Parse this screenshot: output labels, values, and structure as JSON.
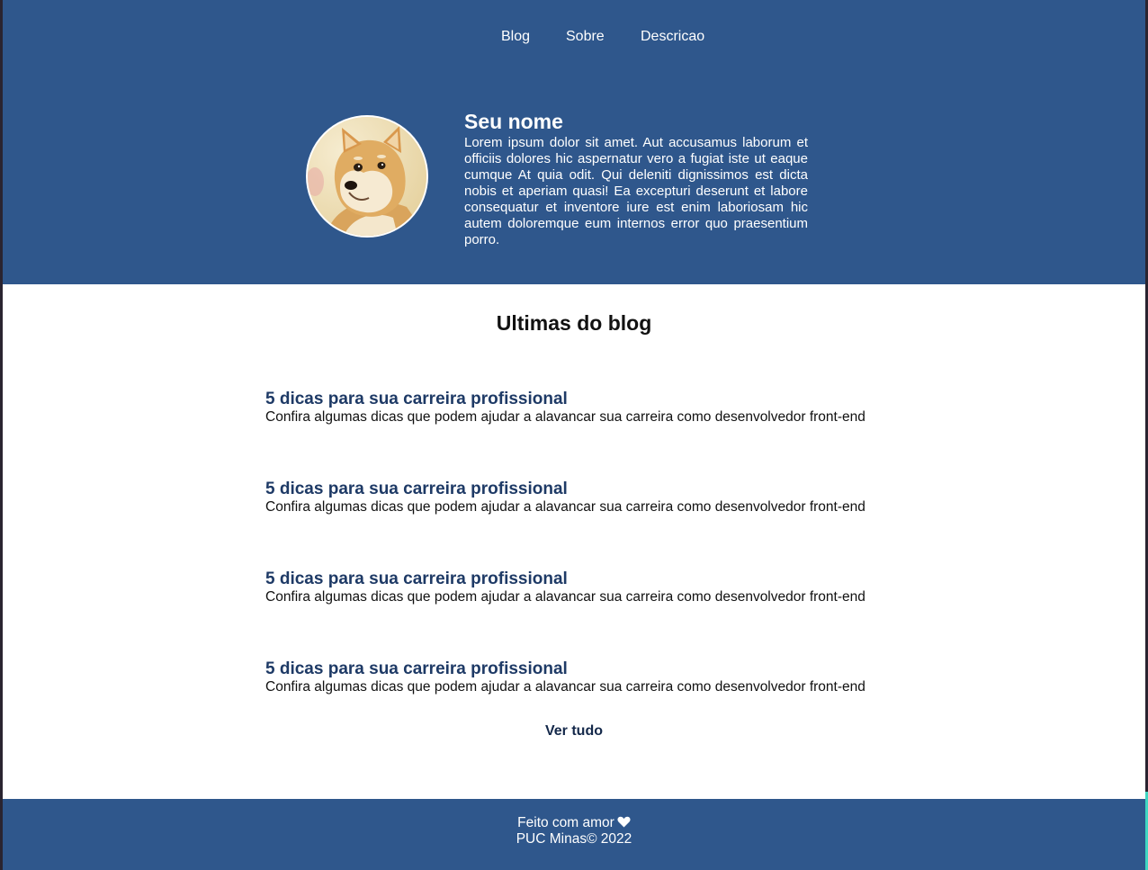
{
  "nav": {
    "items": [
      "Blog",
      "Sobre",
      "Descricao"
    ]
  },
  "profile": {
    "name": "Seu nome",
    "bio": "Lorem ipsum dolor sit amet. Aut accusamus laborum et officiis dolores hic aspernatur vero a fugiat iste ut eaque cumque At quia odit. Qui deleniti dignissimos est dicta nobis et aperiam quasi! Ea excepturi deserunt et labore consequatur et inventore iure est enim laboriosam hic autem doloremque eum internos error quo praesentium porro.",
    "avatar_icon": "dog-avatar-icon"
  },
  "blog": {
    "title": "Ultimas do blog",
    "posts": [
      {
        "title": "5 dicas para sua carreira profissional",
        "description": "Confira algumas dicas que podem ajudar a alavancar sua carreira como desenvolvedor front-end"
      },
      {
        "title": "5 dicas para sua carreira profissional",
        "description": "Confira algumas dicas que podem ajudar a alavancar sua carreira como desenvolvedor front-end"
      },
      {
        "title": "5 dicas para sua carreira profissional",
        "description": "Confira algumas dicas que podem ajudar a alavancar sua carreira como desenvolvedor front-end"
      },
      {
        "title": "5 dicas para sua carreira profissional",
        "description": "Confira algumas dicas que podem ajudar a alavancar sua carreira como desenvolvedor front-end"
      }
    ],
    "see_all": "Ver tudo"
  },
  "footer": {
    "made_with": "Feito com amor",
    "heart_icon": "heart-icon",
    "copyright": "PUC Minas© 2022"
  },
  "colors": {
    "brand": "#2f578c",
    "post_title": "#1e3a66",
    "text": "#111111"
  }
}
